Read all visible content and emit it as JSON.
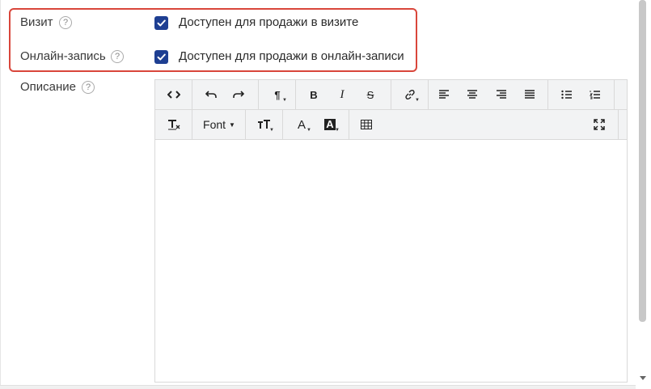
{
  "visit": {
    "label": "Визит",
    "help": "?",
    "checkbox_label": "Доступен для продажи в визите",
    "checked": true
  },
  "online": {
    "label": "Онлайн-запись",
    "help": "?",
    "checkbox_label": "Доступен для продажи в онлайн-записи",
    "checked": true
  },
  "description": {
    "label": "Описание",
    "help": "?"
  },
  "editor": {
    "row1": {
      "code": "<>",
      "undo": "↶",
      "redo": "↷",
      "paragraph": "¶",
      "bold": "B",
      "italic": "I",
      "strike": "S",
      "link": "🔗",
      "align_left": "≡",
      "align_center": "≡",
      "align_right": "≡",
      "justify": "≡",
      "ul": "☰",
      "ol": "☰"
    },
    "row2": {
      "clear_format": "T",
      "font": "Font",
      "font_size": "TT",
      "font_color": "A",
      "highlight": "A",
      "table": "▦",
      "fullscreen": "⛶"
    },
    "content": ""
  },
  "colors": {
    "accent": "#1e3f92",
    "highlight_border": "#d9463b"
  }
}
